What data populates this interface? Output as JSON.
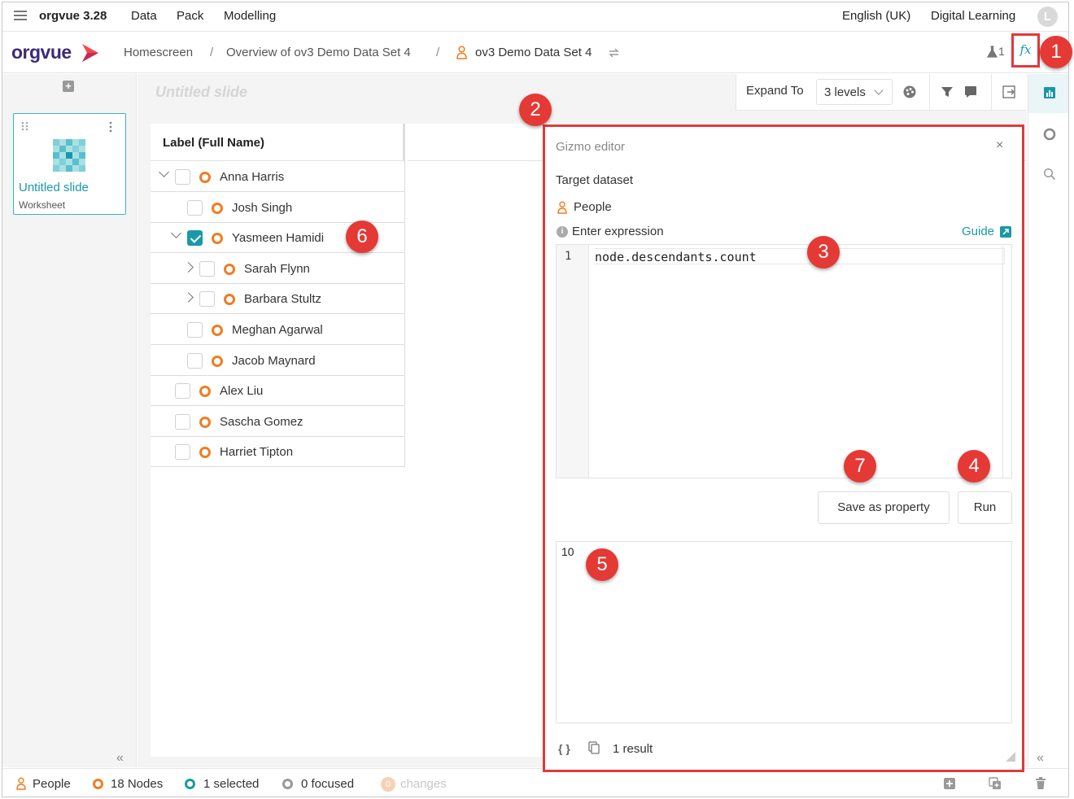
{
  "menubar": {
    "app_title": "orgvue 3.28",
    "menus": [
      "Data",
      "Pack",
      "Modelling"
    ],
    "language": "English (UK)",
    "workspace": "Digital Learning",
    "avatar_initial": "L"
  },
  "breadcrumb": {
    "logo": "orgvue",
    "items": [
      "Homescreen",
      "Overview of ov3 Demo Data Set 4",
      "ov3 Demo Data Set 4"
    ],
    "separator": "/",
    "user_count": "1",
    "fx_label": "fx"
  },
  "slides": {
    "items": [
      {
        "title": "Untitled slide",
        "type": "Worksheet"
      }
    ]
  },
  "slide": {
    "title_placeholder": "Untitled slide"
  },
  "toolbar": {
    "expand_label": "Expand To",
    "expand_value": "3 levels"
  },
  "worksheet": {
    "column_header": "Label (Full Name)",
    "rows": [
      {
        "name": "Anna Harris",
        "checked": false,
        "expander": "down"
      },
      {
        "name": "Josh Singh",
        "checked": false,
        "expander": "none"
      },
      {
        "name": "Yasmeen Hamidi",
        "checked": true,
        "expander": "down"
      },
      {
        "name": "Sarah Flynn",
        "checked": false,
        "expander": "right"
      },
      {
        "name": "Barbara Stultz",
        "checked": false,
        "expander": "right"
      },
      {
        "name": "Meghan Agarwal",
        "checked": false,
        "expander": "none"
      },
      {
        "name": "Jacob Maynard",
        "checked": false,
        "expander": "none"
      },
      {
        "name": "Alex Liu",
        "checked": false,
        "expander": "none"
      },
      {
        "name": "Sascha Gomez",
        "checked": false,
        "expander": "none"
      },
      {
        "name": "Harriet Tipton",
        "checked": false,
        "expander": "none"
      }
    ]
  },
  "gizmo": {
    "title": "Gizmo editor",
    "close": "×",
    "target_label": "Target dataset",
    "dataset": "People",
    "expression_label": "Enter expression",
    "guide_label": "Guide",
    "line_number": "1",
    "code": "node.descendants.count",
    "save_label": "Save as property",
    "run_label": "Run",
    "result": "10",
    "footer_braces": "{ }",
    "result_count": "1 result"
  },
  "status": {
    "dataset": "People",
    "nodes": "18 Nodes",
    "selected": "1 selected",
    "focused": "0 focused",
    "changes_count": "0",
    "changes": "changes"
  },
  "callouts": [
    "1",
    "2",
    "3",
    "4",
    "5",
    "6",
    "7"
  ],
  "colors": {
    "accent": "#1a98a8",
    "brand": "#3d2a78",
    "node_ring": "#ef7d22",
    "annotation": "#e53935"
  }
}
